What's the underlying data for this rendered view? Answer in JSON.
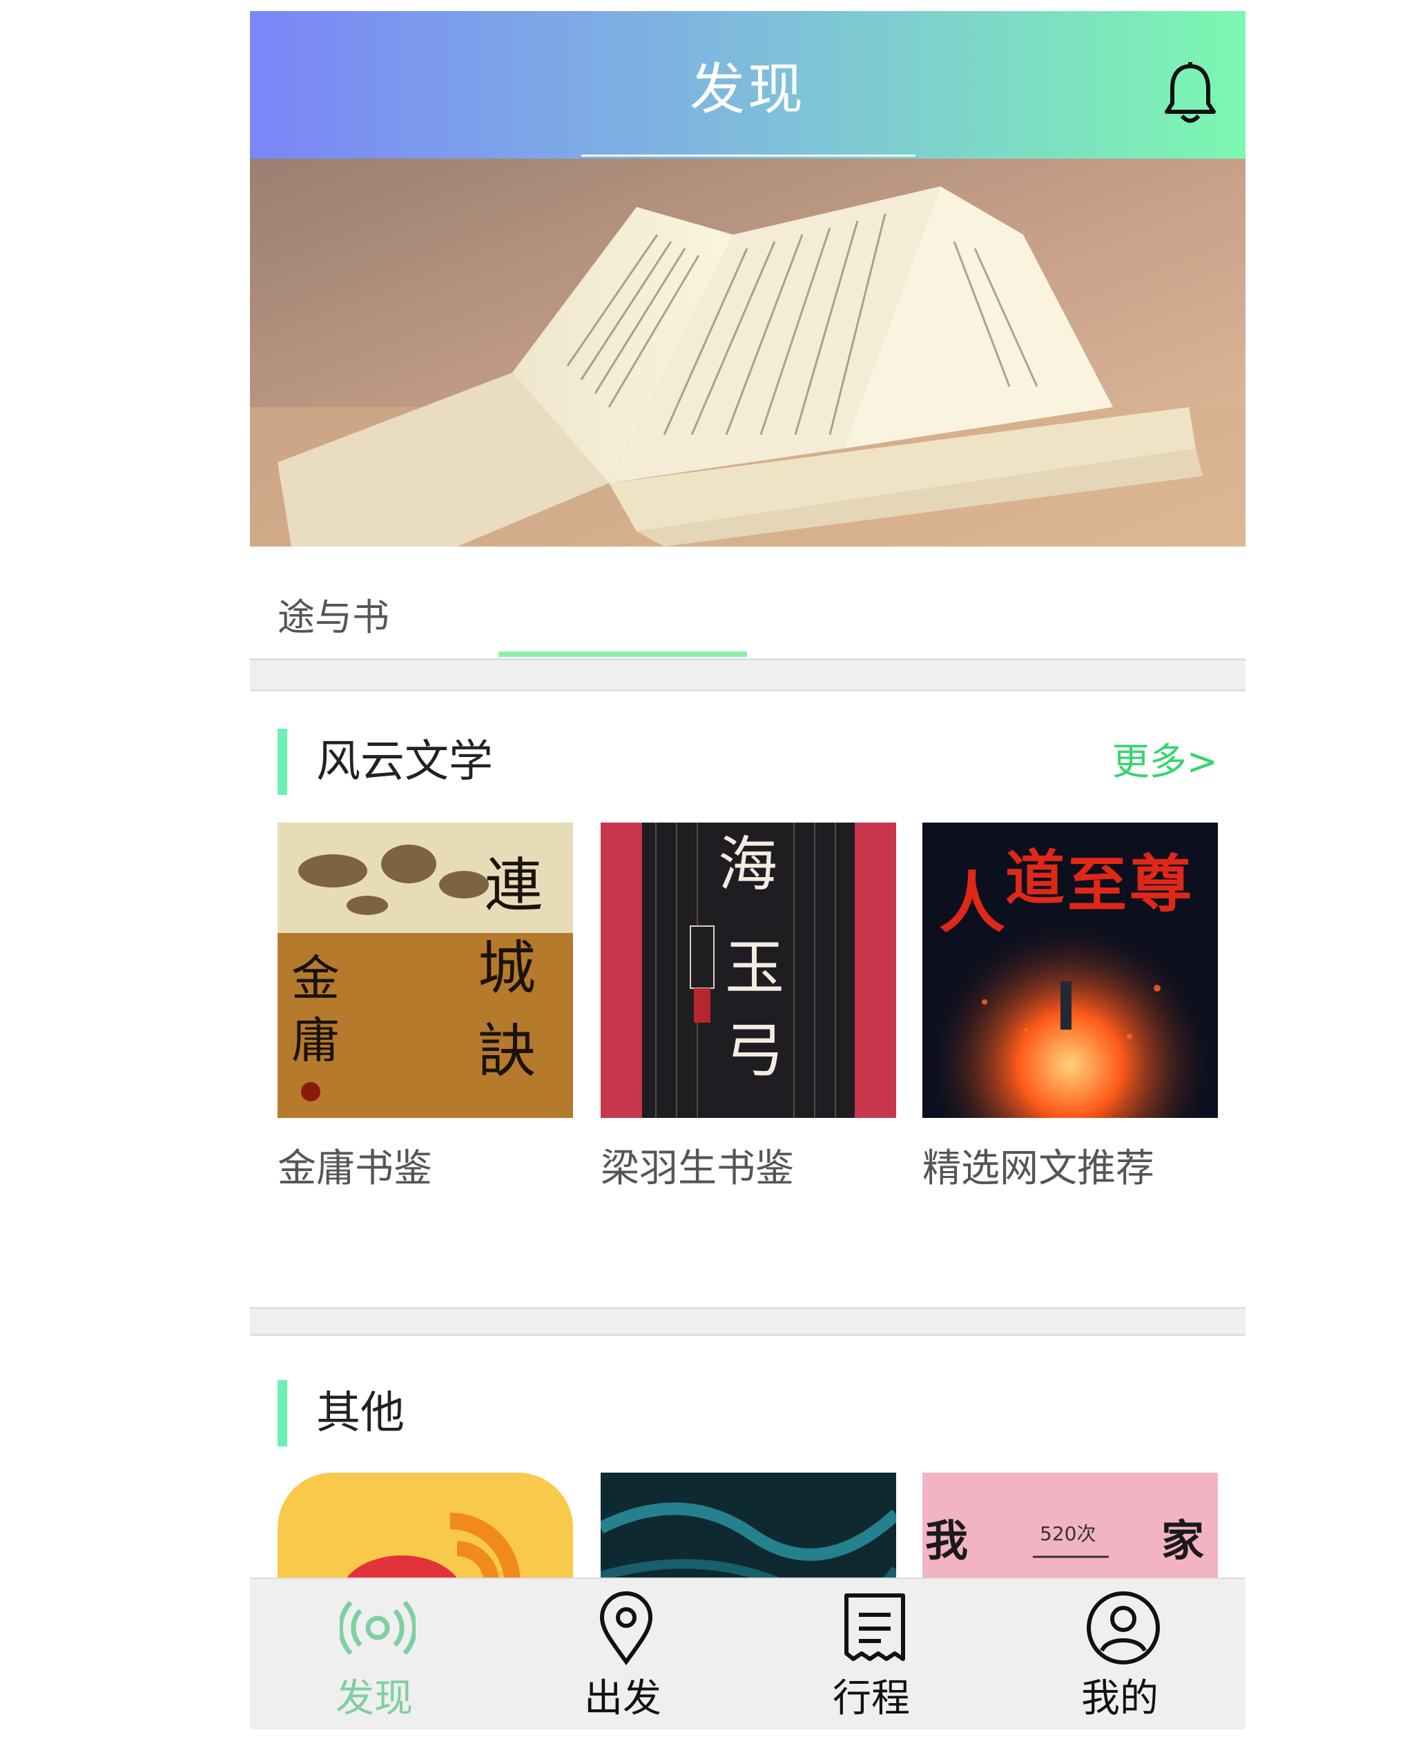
{
  "header": {
    "title": "发现"
  },
  "tabs": {
    "active_label": "途与书"
  },
  "section1": {
    "title": "风云文学",
    "more": "更多>",
    "books": [
      {
        "label": "金庸书鉴"
      },
      {
        "label": "梁羽生书鉴"
      },
      {
        "label": "精选网文推荐"
      }
    ]
  },
  "section2": {
    "title": "其他",
    "tile3_text": "520次"
  },
  "tabbar": {
    "items": [
      {
        "label": "发现",
        "icon": "radio-wave-icon",
        "active": true
      },
      {
        "label": "出发",
        "icon": "location-pin-icon",
        "active": false
      },
      {
        "label": "行程",
        "icon": "receipt-icon",
        "active": false
      },
      {
        "label": "我的",
        "icon": "user-icon",
        "active": false
      }
    ]
  },
  "colors": {
    "accent": "#6ef0b4",
    "more": "#35d56e",
    "tab_active": "#7fcf9f"
  }
}
